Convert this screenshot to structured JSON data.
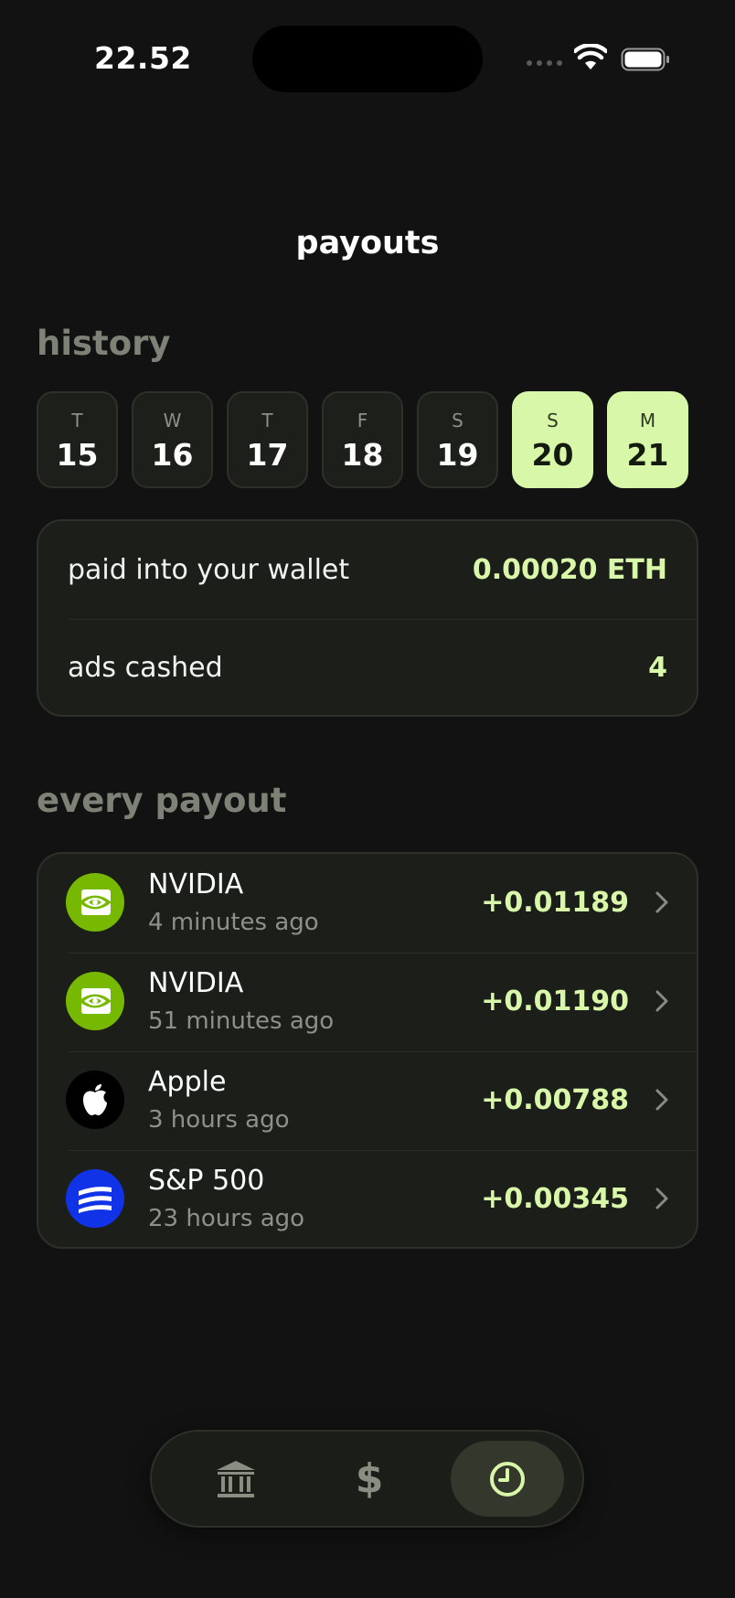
{
  "status_bar": {
    "time": "22.52",
    "icons": [
      "cellular-signal-icon",
      "wifi-icon",
      "battery-icon"
    ]
  },
  "header": {
    "title": "payouts"
  },
  "history": {
    "title": "history",
    "days": [
      {
        "letter": "T",
        "number": "15",
        "selected": false
      },
      {
        "letter": "W",
        "number": "16",
        "selected": false
      },
      {
        "letter": "T",
        "number": "17",
        "selected": false
      },
      {
        "letter": "F",
        "number": "18",
        "selected": false
      },
      {
        "letter": "S",
        "number": "19",
        "selected": false
      },
      {
        "letter": "S",
        "number": "20",
        "selected": true
      },
      {
        "letter": "M",
        "number": "21",
        "selected": true
      }
    ]
  },
  "summary": {
    "wallet_label": "paid into your wallet",
    "wallet_value": "0.00020 ETH",
    "ads_label": "ads cashed",
    "ads_value": "4"
  },
  "every_payout": {
    "title": "every payout",
    "items": [
      {
        "name": "NVIDIA",
        "time": "4 minutes ago",
        "amount": "+0.01189",
        "logo": "nvidia-logo"
      },
      {
        "name": "NVIDIA",
        "time": "51 minutes ago",
        "amount": "+0.01190",
        "logo": "nvidia-logo"
      },
      {
        "name": "Apple",
        "time": "3 hours ago",
        "amount": "+0.00788",
        "logo": "apple-logo"
      },
      {
        "name": "S&P 500",
        "time": "23 hours ago",
        "amount": "+0.00345",
        "logo": "sp500-logo"
      }
    ]
  },
  "tab_bar": {
    "items": [
      {
        "icon": "bank-icon",
        "active": false
      },
      {
        "icon": "dollar-icon",
        "label": "$",
        "active": false
      },
      {
        "icon": "clock-icon",
        "active": true
      }
    ]
  },
  "colors": {
    "background": "#121212",
    "card": "#1c1e19",
    "accent": "#d9f7a9",
    "muted_heading": "#7e8176",
    "nvidia_green": "#76b900",
    "sp500_blue": "#1133e8"
  }
}
